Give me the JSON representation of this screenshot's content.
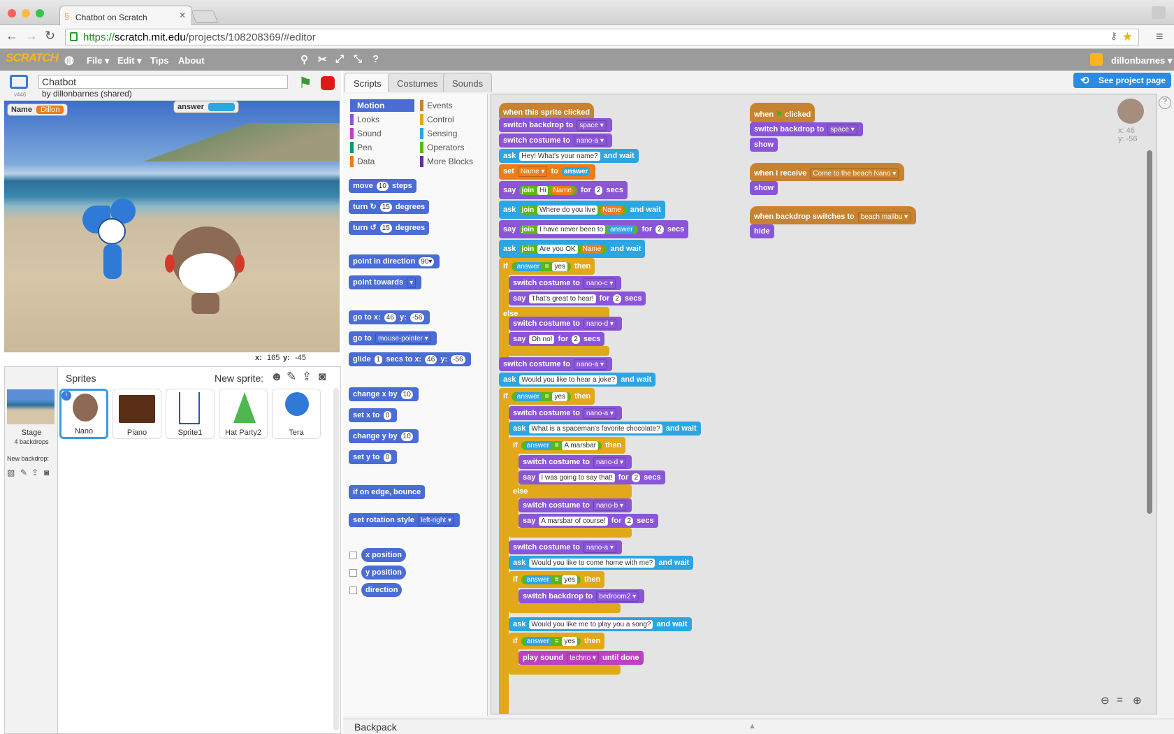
{
  "browser": {
    "tab_title": "Chatbot on Scratch",
    "url_prefix": "https://",
    "url_host": "scratch.mit.edu",
    "url_path": "/projects/108208369/#editor"
  },
  "menu": {
    "file": "File ▾",
    "edit": "Edit ▾",
    "tips": "Tips",
    "about": "About",
    "user": "dillonbarnes ▾",
    "logo": "SCRATCH"
  },
  "project": {
    "title": "Chatbot",
    "by": "by dillonbarnes (shared)",
    "version": "v446"
  },
  "monitors": {
    "name_label": "Name",
    "name_value": "Dillon",
    "answer_label": "answer"
  },
  "stage": {
    "xy_x_label": "x:",
    "x": "165",
    "xy_y_label": "y:",
    "y": "-45"
  },
  "sprites": {
    "header": "Sprites",
    "new_sprite": "New sprite:",
    "stage_label": "Stage",
    "stage_sub": "4 backdrops",
    "new_backdrop": "New backdrop:",
    "items": [
      "Nano",
      "Piano",
      "Sprite1",
      "Hat Party2",
      "Tera"
    ]
  },
  "tabs": {
    "scripts": "Scripts",
    "costumes": "Costumes",
    "sounds": "Sounds"
  },
  "see_project": "See project page",
  "categories": {
    "motion": "Motion",
    "looks": "Looks",
    "sound": "Sound",
    "pen": "Pen",
    "data": "Data",
    "events": "Events",
    "control": "Control",
    "sensing": "Sensing",
    "operators": "Operators",
    "more": "More Blocks"
  },
  "sprite_info": {
    "x": "x: 46",
    "y": "y: -56"
  },
  "backpack": "Backpack",
  "colors": {
    "motion": "#4a6cd4",
    "looks": "#8a55d7",
    "sound": "#bb42c3",
    "pen": "#0e9a6c",
    "data": "#ee7d16",
    "events": "#c88330",
    "control": "#e1a91a",
    "sensing": "#2ca5e2",
    "operators": "#5cb712",
    "more": "#632d99"
  }
}
